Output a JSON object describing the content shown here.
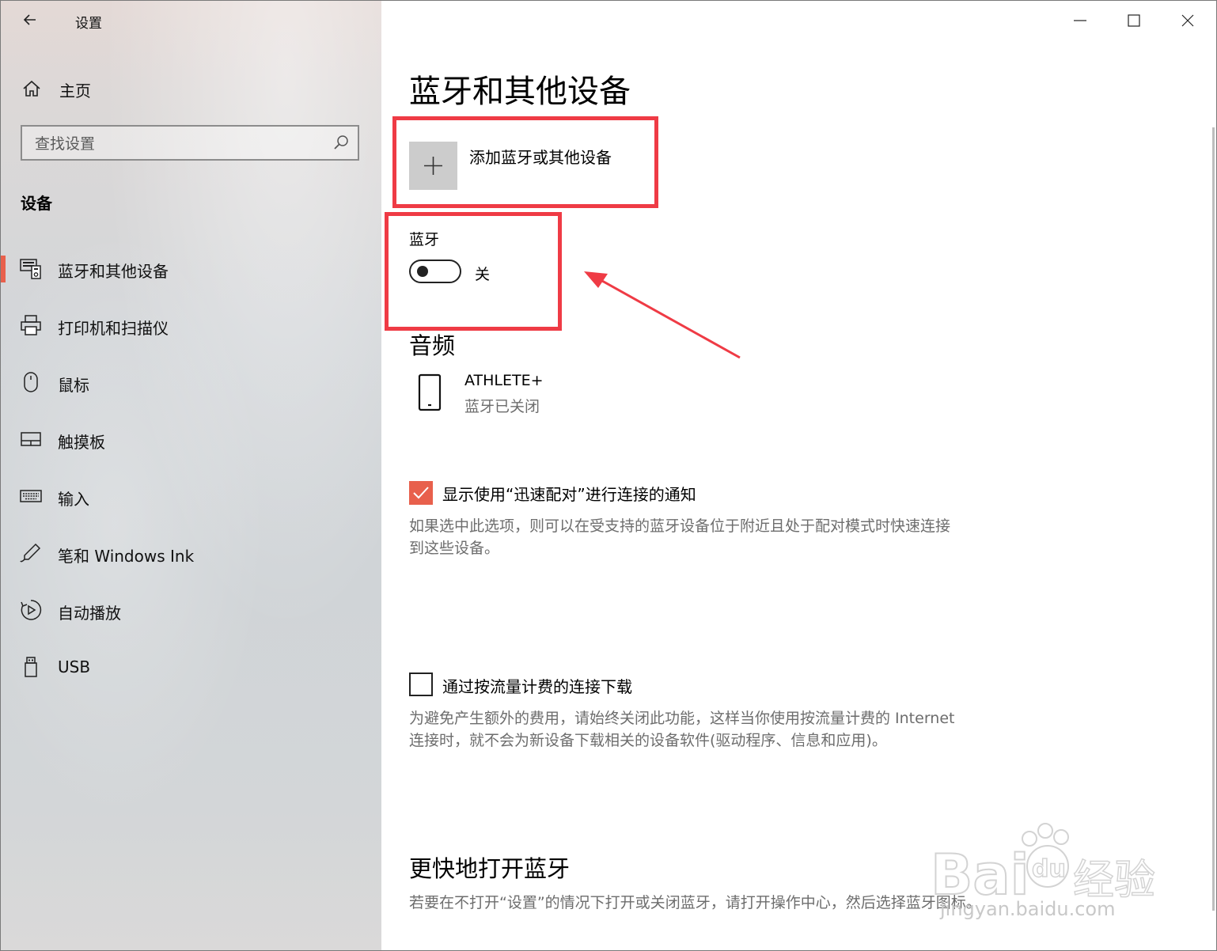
{
  "window": {
    "app_title": "设置",
    "controls": [
      "minimize",
      "maximize",
      "close"
    ]
  },
  "sidebar": {
    "home_label": "主页",
    "search_placeholder": "查找设置",
    "section_title": "设备",
    "items": [
      {
        "label": "蓝牙和其他设备",
        "icon": "bluetooth-devices-icon",
        "active": true
      },
      {
        "label": "打印机和扫描仪",
        "icon": "printer-icon",
        "active": false
      },
      {
        "label": "鼠标",
        "icon": "mouse-icon",
        "active": false
      },
      {
        "label": "触摸板",
        "icon": "touchpad-icon",
        "active": false
      },
      {
        "label": "输入",
        "icon": "keyboard-icon",
        "active": false
      },
      {
        "label": "笔和 Windows Ink",
        "icon": "pen-icon",
        "active": false
      },
      {
        "label": "自动播放",
        "icon": "autoplay-icon",
        "active": false
      },
      {
        "label": "USB",
        "icon": "usb-icon",
        "active": false
      }
    ]
  },
  "main": {
    "page_title": "蓝牙和其他设备",
    "add_device_label": "添加蓝牙或其他设备",
    "bluetooth_label": "蓝牙",
    "bluetooth_state": "关",
    "bluetooth_on": false,
    "audio_title": "音频",
    "audio_device": {
      "name": "ATHLETE+",
      "status": "蓝牙已关闭"
    },
    "swift_pair": {
      "checked": true,
      "label": "显示使用“迅速配对”进行连接的通知",
      "description": "如果选中此选项，则可以在受支持的蓝牙设备位于附近且处于配对模式时快速连接到这些设备。"
    },
    "metered": {
      "checked": false,
      "label": "通过按流量计费的连接下载",
      "description": "为避免产生额外的费用，请始终关闭此功能，这样当你使用按流量计费的 Internet 连接时，就不会为新设备下载相关的设备软件(驱动程序、信息和应用)。"
    },
    "quick_title": "更快地打开蓝牙",
    "quick_description": "若要在不打开“设置”的情况下打开或关闭蓝牙，请打开操作中心，然后选择蓝牙图标。"
  },
  "annotations": {
    "highlight_color": "#ef3b45",
    "accent_color": "#e8604c"
  },
  "watermark": {
    "text": "jingyan.baidu.com",
    "brand": "Baidu经验"
  }
}
